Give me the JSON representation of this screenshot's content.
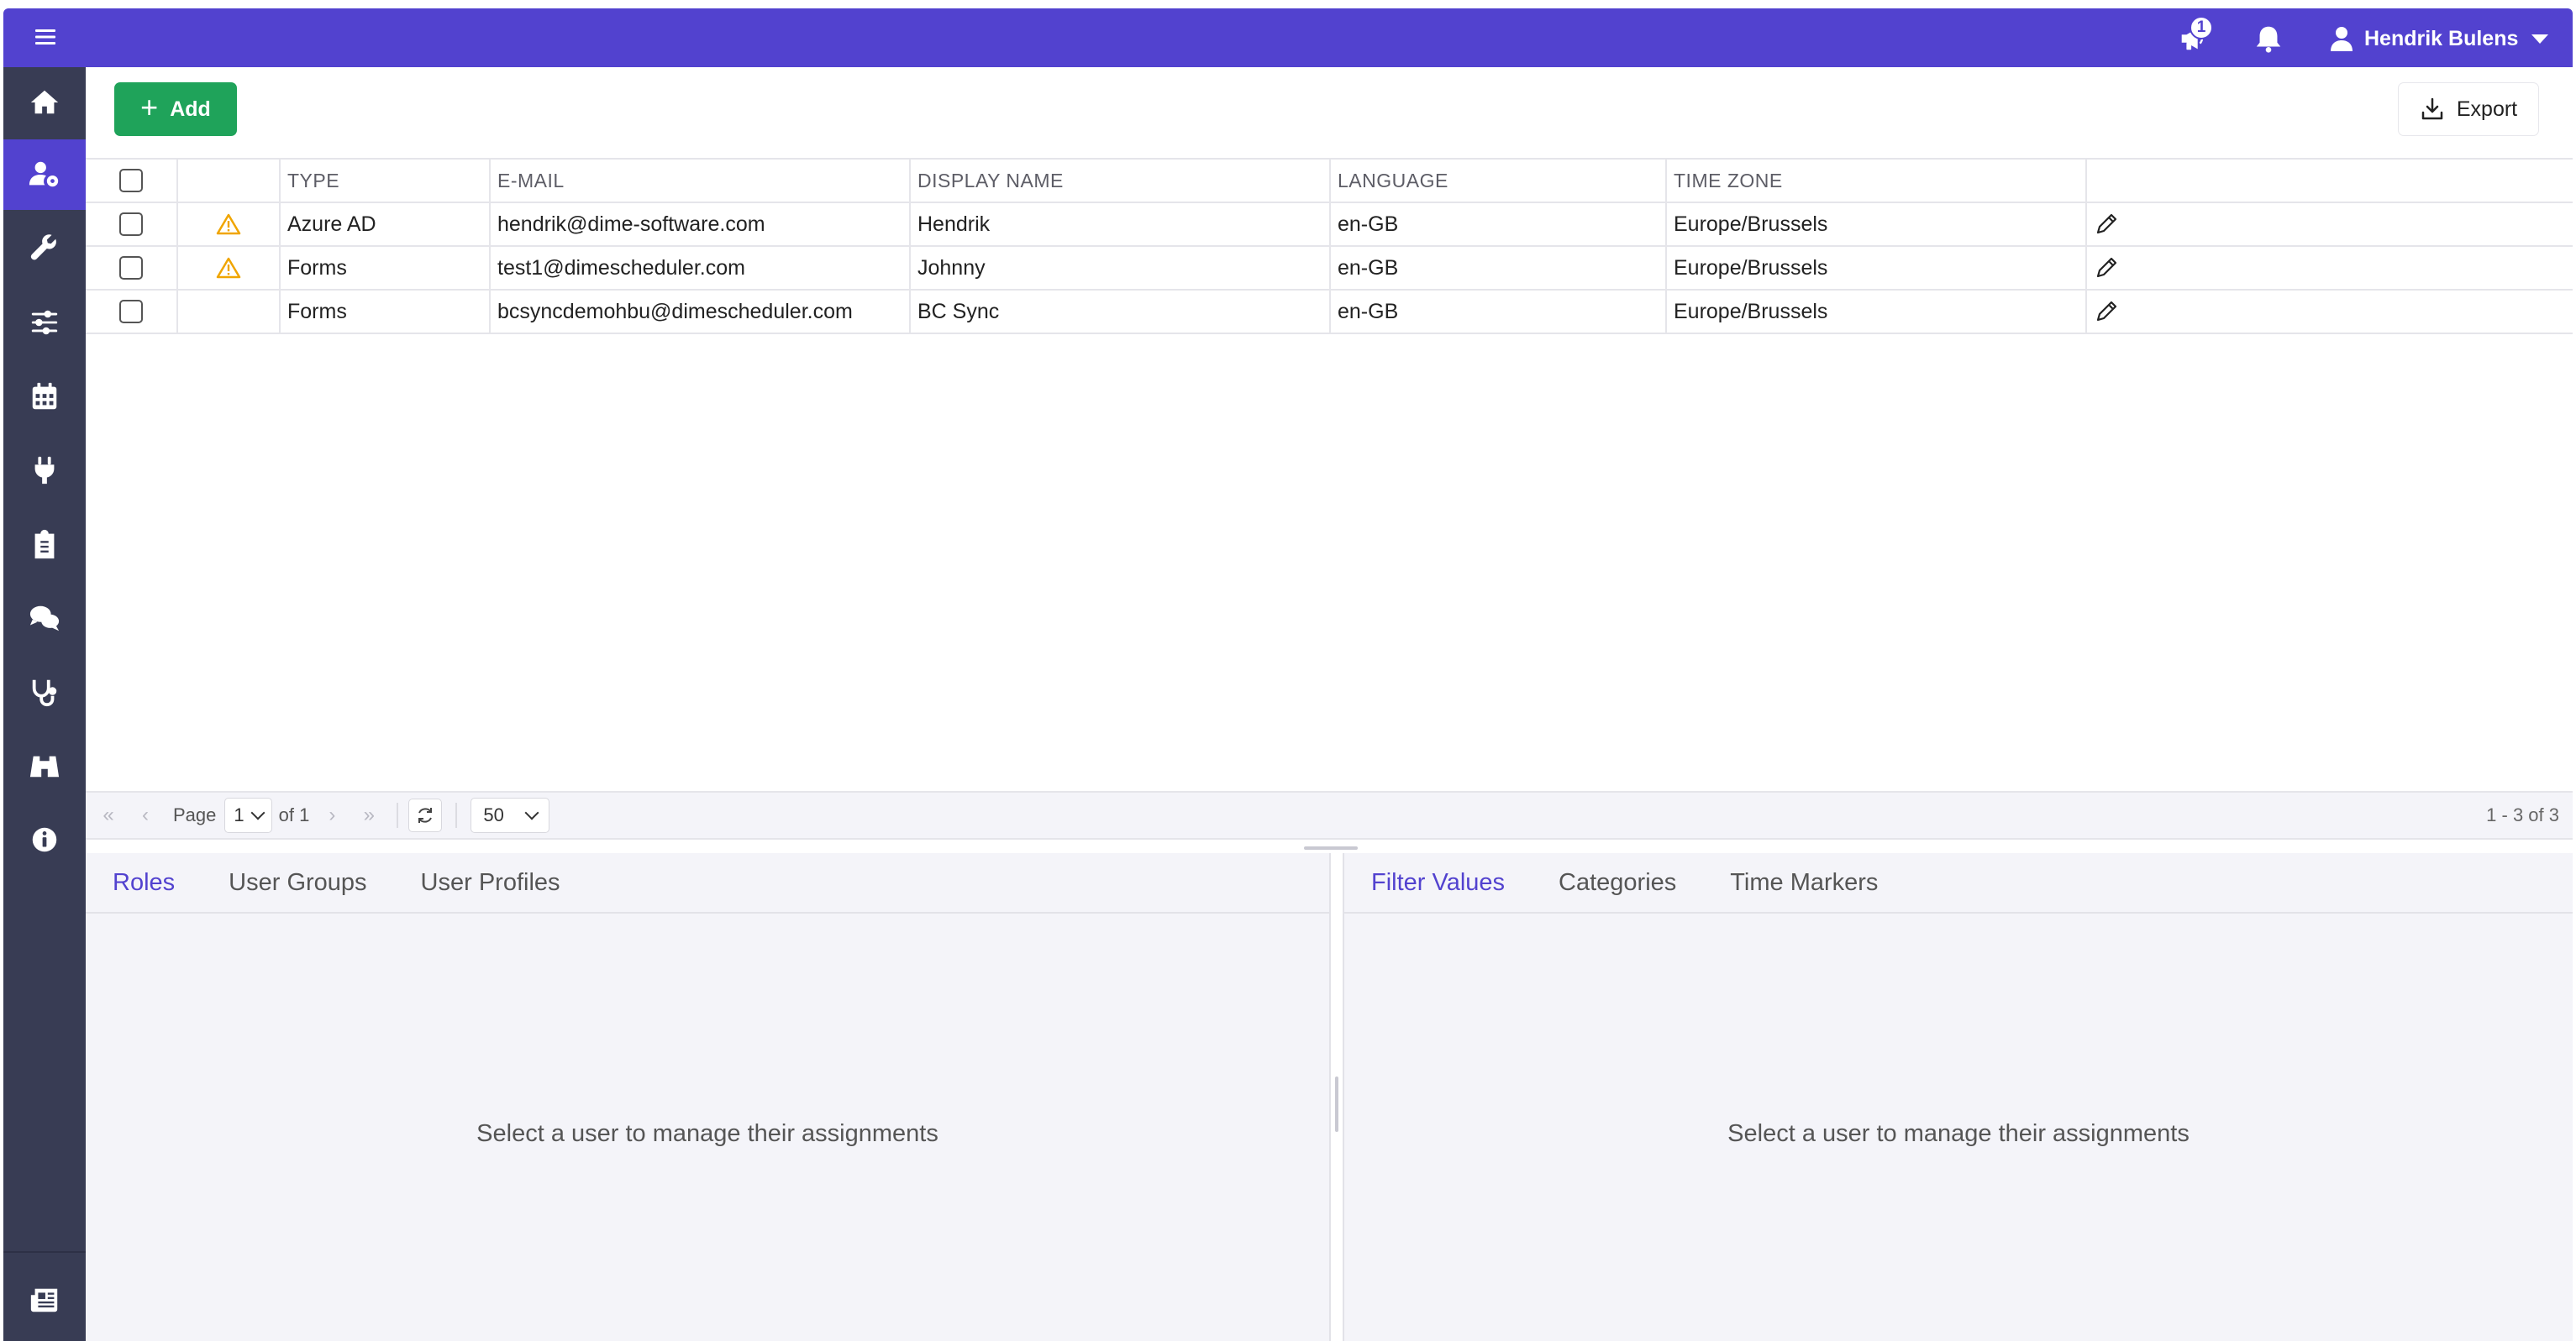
{
  "topbar": {
    "notification_count": "1",
    "user_name": "Hendrik Bulens"
  },
  "toolbar": {
    "add_label": "Add",
    "export_label": "Export"
  },
  "table": {
    "columns": [
      "",
      "",
      "TYPE",
      "E-MAIL",
      "DISPLAY NAME",
      "LANGUAGE",
      "TIME ZONE",
      ""
    ],
    "rows": [
      {
        "warning": true,
        "type": "Azure AD",
        "email": "hendrik@dime-software.com",
        "display_name": "Hendrik",
        "language": "en-GB",
        "time_zone": "Europe/Brussels"
      },
      {
        "warning": true,
        "type": "Forms",
        "email": "test1@dimescheduler.com",
        "display_name": "Johnny",
        "language": "en-GB",
        "time_zone": "Europe/Brussels"
      },
      {
        "warning": false,
        "type": "Forms",
        "email": "bcsyncdemohbu@dimescheduler.com",
        "display_name": "BC Sync",
        "language": "en-GB",
        "time_zone": "Europe/Brussels"
      }
    ]
  },
  "pager": {
    "first": "«",
    "prev": "‹",
    "page_label": "Page",
    "page_value": "1",
    "of_label": "of 1",
    "next": "›",
    "last": "»",
    "page_size": "50",
    "summary": "1 - 3 of 3"
  },
  "left_panel": {
    "tabs": [
      "Roles",
      "User Groups",
      "User Profiles"
    ],
    "active_tab": "Roles",
    "empty_message": "Select a user to manage their assignments"
  },
  "right_panel": {
    "tabs": [
      "Filter Values",
      "Categories",
      "Time Markers"
    ],
    "active_tab": "Filter Values",
    "empty_message": "Select a user to manage their assignments"
  },
  "sidebar": {
    "items": [
      "home-icon",
      "user-settings-icon",
      "wrench-icon",
      "sliders-icon",
      "calendar-icon",
      "plug-icon",
      "clipboard-icon",
      "chat-icon",
      "stethoscope-icon",
      "binoculars-icon",
      "info-icon",
      "newspaper-icon"
    ],
    "active": "user-settings-icon"
  },
  "colors": {
    "brand": "#5242cf",
    "sidebar": "#383c54",
    "add_button": "#1fa35a",
    "warning": "#f0a500"
  }
}
